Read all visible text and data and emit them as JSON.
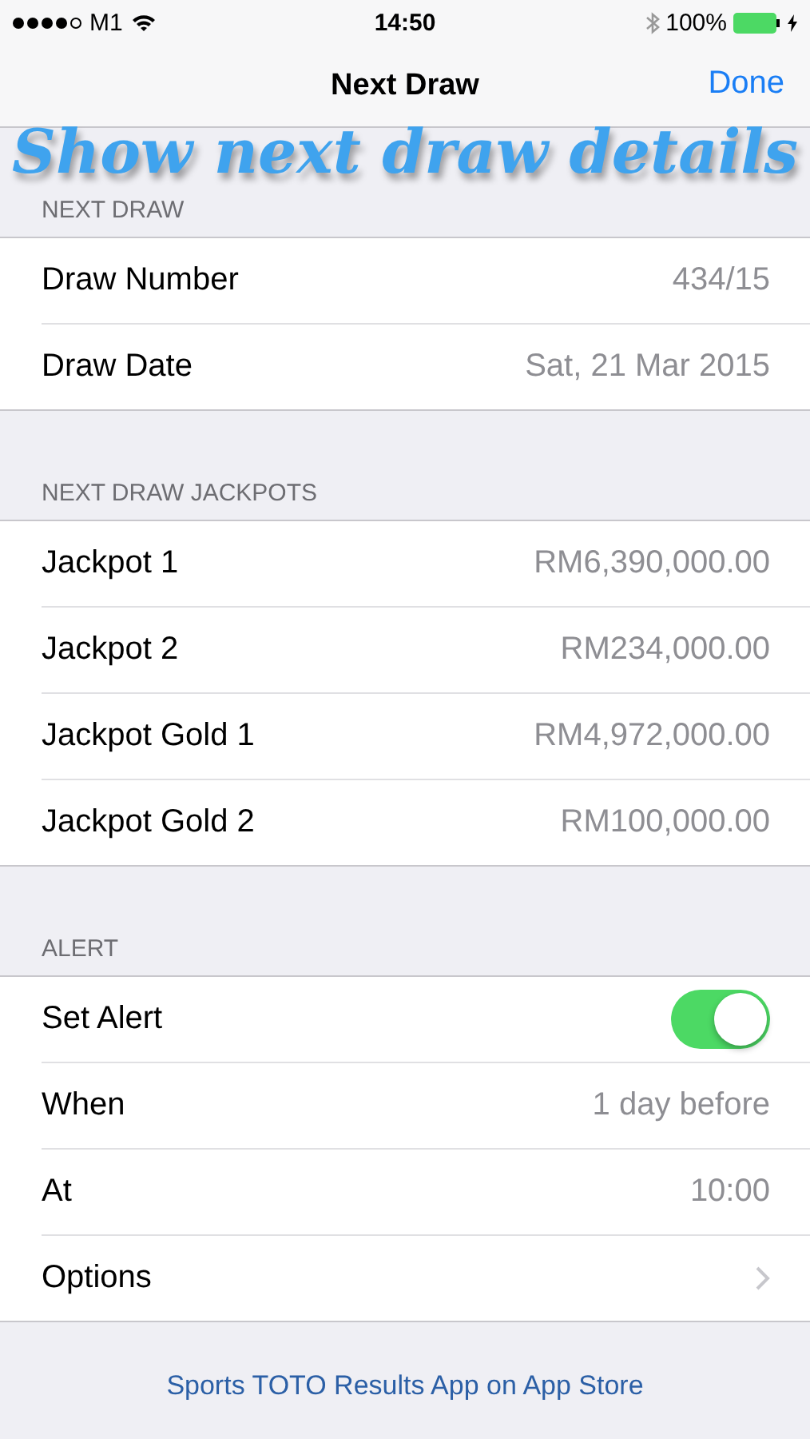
{
  "status_bar": {
    "carrier": "M1",
    "time": "14:50",
    "battery": "100%"
  },
  "nav": {
    "title": "Next Draw",
    "done": "Done"
  },
  "caption": "Show next draw details",
  "sections": [
    {
      "header": "NEXT DRAW",
      "rows": [
        {
          "kind": "value",
          "label": "Draw Number",
          "value": "434/15"
        },
        {
          "kind": "value",
          "label": "Draw Date",
          "value": "Sat, 21 Mar 2015"
        }
      ]
    },
    {
      "header": "NEXT DRAW JACKPOTS",
      "rows": [
        {
          "kind": "value",
          "label": "Jackpot 1",
          "value": "RM6,390,000.00"
        },
        {
          "kind": "value",
          "label": "Jackpot 2",
          "value": "RM234,000.00"
        },
        {
          "kind": "value",
          "label": "Jackpot Gold 1",
          "value": "RM4,972,000.00"
        },
        {
          "kind": "value",
          "label": "Jackpot Gold 2",
          "value": "RM100,000.00"
        }
      ]
    },
    {
      "header": "ALERT",
      "rows": [
        {
          "kind": "toggle",
          "label": "Set Alert",
          "on": true
        },
        {
          "kind": "value",
          "label": "When",
          "value": "1 day before"
        },
        {
          "kind": "value",
          "label": "At",
          "value": "10:00"
        },
        {
          "kind": "disclosure",
          "label": "Options"
        }
      ]
    }
  ],
  "footer_link": "Sports TOTO Results App on App Store"
}
